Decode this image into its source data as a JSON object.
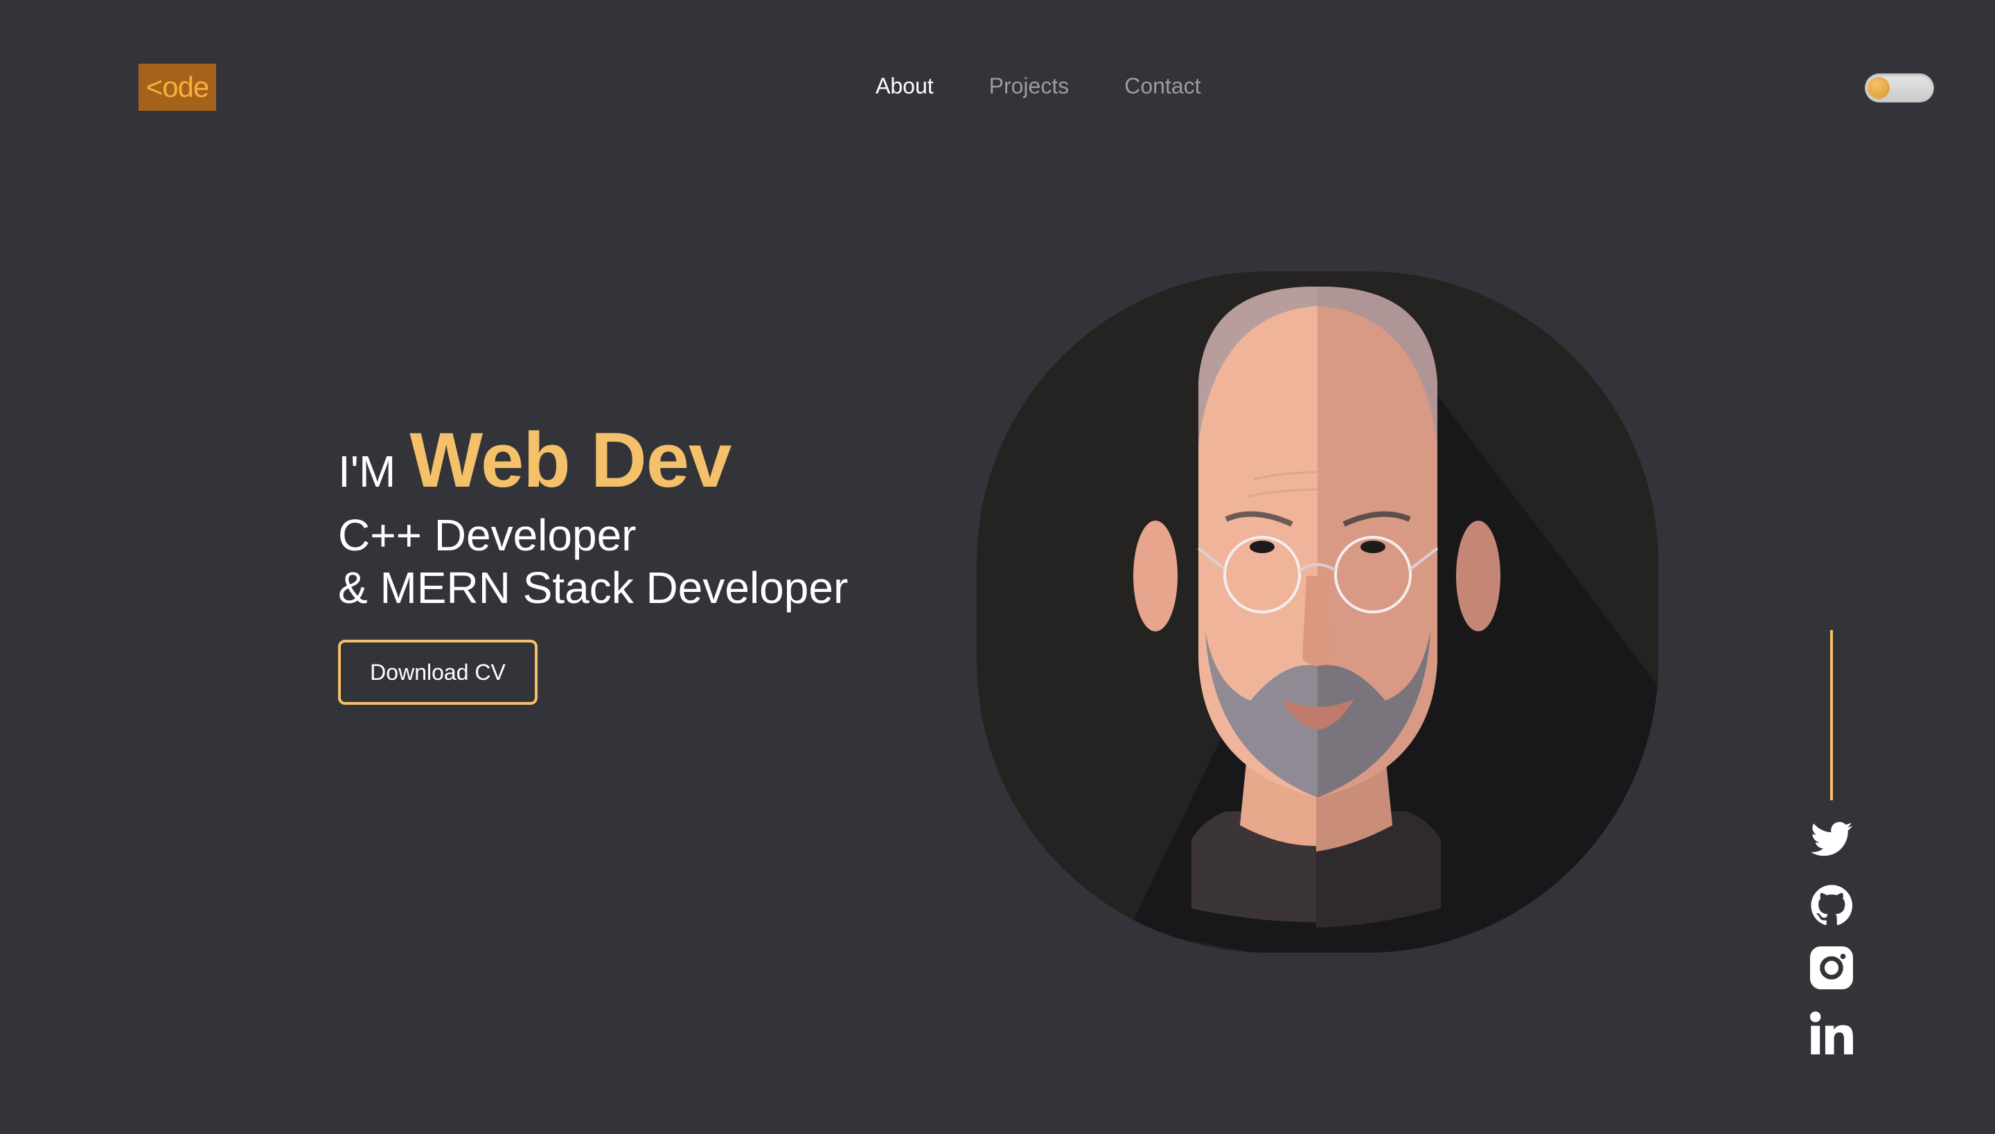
{
  "header": {
    "logo_text": "<ode",
    "nav": [
      {
        "label": "About",
        "active": true
      },
      {
        "label": "Projects",
        "active": false
      },
      {
        "label": "Contact",
        "active": false
      }
    ],
    "theme_toggle": {
      "icon": "theme-toggle-icon"
    }
  },
  "hero": {
    "intro": "I'M",
    "role": "Web Dev",
    "line2": "C++ Developer",
    "line3": "& MERN Stack Developer",
    "cta_label": "Download CV"
  },
  "social": [
    {
      "name": "twitter",
      "icon": "twitter-icon"
    },
    {
      "name": "github",
      "icon": "github-icon"
    },
    {
      "name": "instagram",
      "icon": "instagram-icon"
    },
    {
      "name": "linkedin",
      "icon": "linkedin-icon"
    }
  ],
  "colors": {
    "background": "#333439",
    "accent": "#f5c06a",
    "logo_bg": "#a6621a",
    "logo_text": "#f5b03c",
    "nav_inactive": "#9a9ba0"
  }
}
